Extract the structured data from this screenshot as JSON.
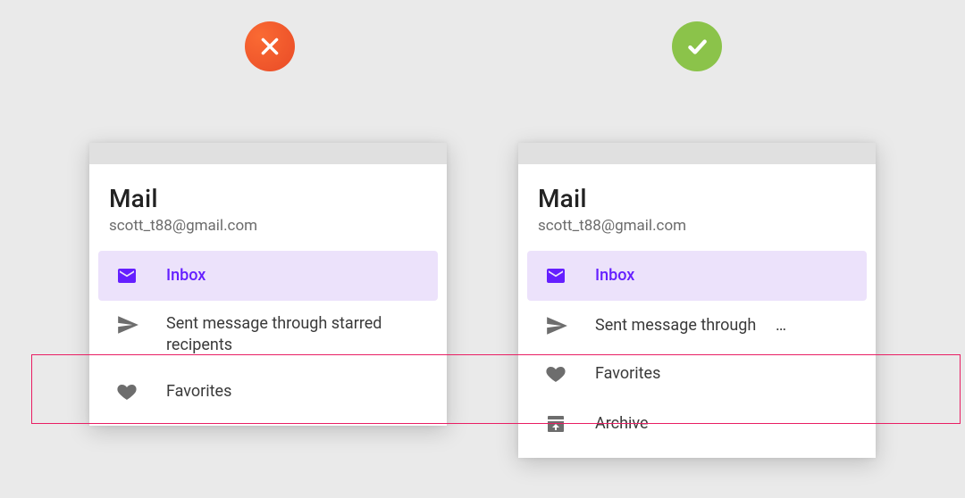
{
  "badges": {
    "dont": "cross-icon",
    "do": "check-icon"
  },
  "panels": {
    "left": {
      "title": "Mail",
      "email": "scott_t88@gmail.com",
      "items": [
        {
          "icon": "envelope-icon",
          "label": "Inbox",
          "active": true
        },
        {
          "icon": "send-icon",
          "label": "Sent message through starred recipents",
          "wrap": true
        },
        {
          "icon": "heart-icon",
          "label": "Favorites"
        }
      ]
    },
    "right": {
      "title": "Mail",
      "email": "scott_t88@gmail.com",
      "items": [
        {
          "icon": "envelope-icon",
          "label": "Inbox",
          "active": true
        },
        {
          "icon": "send-icon",
          "label": "Sent message through",
          "ellipsis": "…"
        },
        {
          "icon": "heart-icon",
          "label": "Favorites"
        },
        {
          "icon": "archive-icon",
          "label": "Archive"
        }
      ]
    }
  }
}
